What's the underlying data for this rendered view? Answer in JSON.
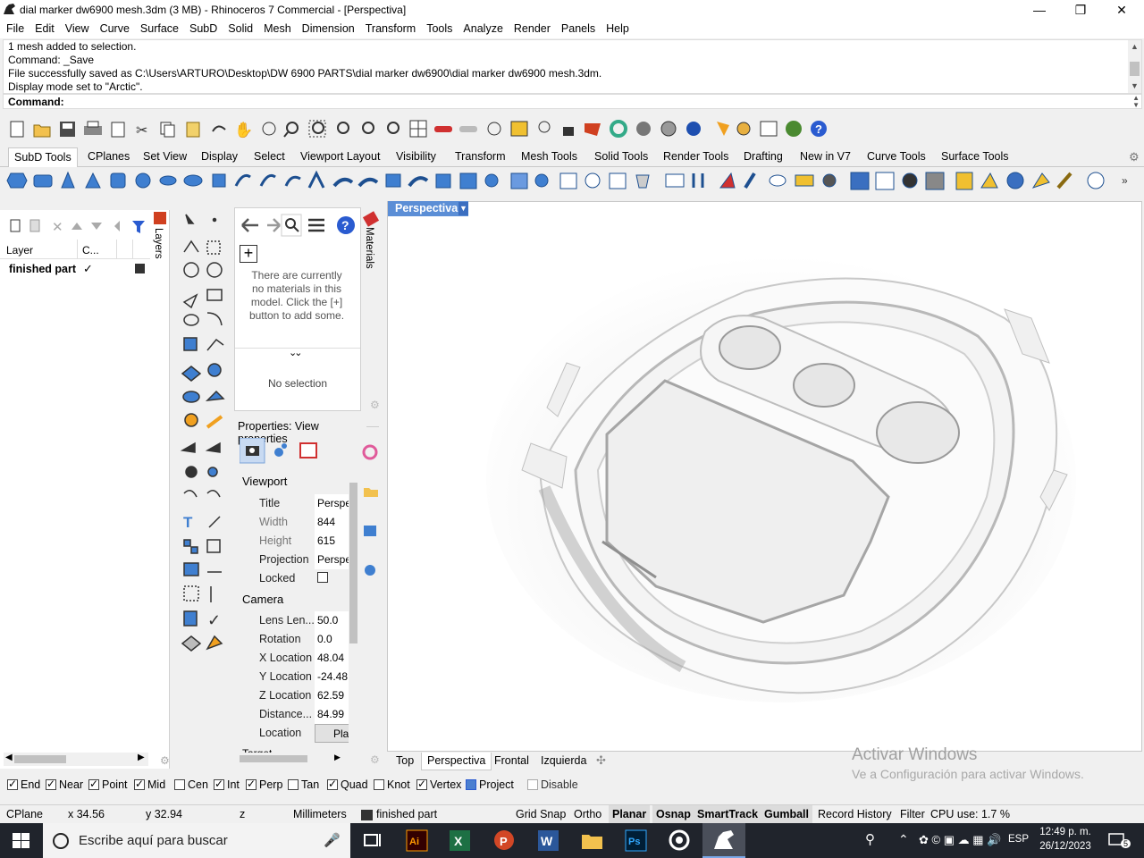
{
  "window": {
    "title": "dial marker dw6900 mesh.3dm (3 MB) - Rhinoceros 7 Commercial - [Perspectiva]",
    "minimize": "—",
    "maximize": "❐",
    "close": "✕"
  },
  "menu": [
    "File",
    "Edit",
    "View",
    "Curve",
    "Surface",
    "SubD",
    "Solid",
    "Mesh",
    "Dimension",
    "Transform",
    "Tools",
    "Analyze",
    "Render",
    "Panels",
    "Help"
  ],
  "command_history": [
    "1 mesh added to selection.",
    "Command: _Save",
    "File successfully saved as C:\\Users\\ARTURO\\Desktop\\DW 6900 PARTS\\dial marker dw6900\\dial marker dw6900 mesh.3dm.",
    "Display mode set to \"Arctic\"."
  ],
  "command_prompt": "Command:",
  "toolbar_tabs": [
    "SubD Tools",
    "CPlanes",
    "Set View",
    "Display",
    "Select",
    "Viewport Layout",
    "Visibility",
    "Transform",
    "Mesh Tools",
    "Solid Tools",
    "Render Tools",
    "Drafting",
    "New in V7",
    "Curve Tools",
    "Surface Tools"
  ],
  "layers": {
    "tab_label": "Layers",
    "col_layer": "Layer",
    "col_current": "C...",
    "rows": [
      {
        "name": "finished part",
        "current": "✓"
      }
    ]
  },
  "materials": {
    "tab_label": "Materials",
    "empty_message": "There are currently no materials in this model. Click the [+] button to add some.",
    "expand": "⌄⌄",
    "selection": "No selection"
  },
  "properties": {
    "header": "Properties: View properties",
    "section_viewport": "Viewport",
    "section_camera": "Camera",
    "cut_label": "Target",
    "viewport_rows": [
      {
        "key": "Title",
        "value": "Perspectiva"
      },
      {
        "key": "Width",
        "value": "844"
      },
      {
        "key": "Height",
        "value": "615"
      },
      {
        "key": "Projection",
        "value": "Perspective"
      },
      {
        "key": "Locked",
        "value": ""
      }
    ],
    "camera_rows": [
      {
        "key": "Lens Len...",
        "value": "50.0"
      },
      {
        "key": "Rotation",
        "value": "0.0"
      },
      {
        "key": "X Location",
        "value": "48.04"
      },
      {
        "key": "Y Location",
        "value": "-24.48"
      },
      {
        "key": "Z Location",
        "value": "62.59"
      },
      {
        "key": "Distance...",
        "value": "84.99"
      },
      {
        "key": "Location",
        "value": "Place..."
      }
    ]
  },
  "viewport": {
    "name": "Perspectiva",
    "tabs": [
      "Top",
      "Perspectiva",
      "Frontal",
      "Izquierda"
    ],
    "active_tab": "Perspectiva"
  },
  "watermark": {
    "line1": "Activar Windows",
    "line2": "Ve a Configuración para activar Windows."
  },
  "osnaps": [
    {
      "label": "End",
      "checked": true
    },
    {
      "label": "Near",
      "checked": true
    },
    {
      "label": "Point",
      "checked": true
    },
    {
      "label": "Mid",
      "checked": true
    },
    {
      "label": "Cen",
      "checked": false
    },
    {
      "label": "Int",
      "checked": true
    },
    {
      "label": "Perp",
      "checked": true
    },
    {
      "label": "Tan",
      "checked": false
    },
    {
      "label": "Quad",
      "checked": true
    },
    {
      "label": "Knot",
      "checked": false
    },
    {
      "label": "Vertex",
      "checked": true
    },
    {
      "label": "Project",
      "checked": false
    },
    {
      "label": "Disable",
      "checked": false
    }
  ],
  "status": {
    "cplane": "CPlane",
    "x": "x 34.56",
    "y": "y 32.94",
    "z": "z",
    "units": "Millimeters",
    "layer": "finished part",
    "grid_snap": "Grid Snap",
    "ortho": "Ortho",
    "planar": "Planar",
    "osnap": "Osnap",
    "smarttrack": "SmartTrack",
    "gumball": "Gumball",
    "record_history": "Record History",
    "filter": "Filter",
    "cpu": "CPU use: 1.7 %"
  },
  "taskbar": {
    "search_placeholder": "Escribe aquí para buscar",
    "lang": "ESP",
    "time": "12:49 p. m.",
    "date": "26/12/2023",
    "notif_count": "5"
  }
}
